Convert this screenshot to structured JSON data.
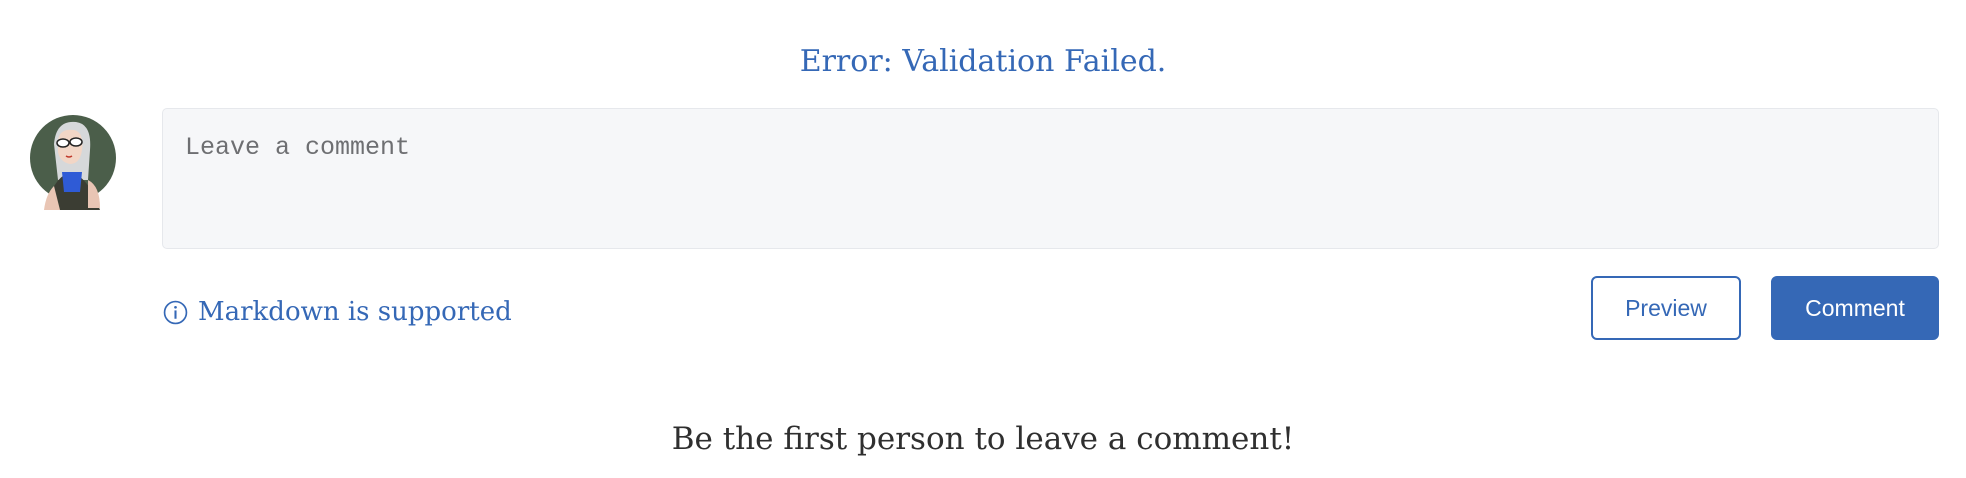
{
  "error": {
    "message": "Error: Validation Failed.",
    "color": "#3568b6"
  },
  "avatar": {
    "icon": "user-avatar-illustration"
  },
  "comment": {
    "placeholder": "Leave a comment",
    "value": ""
  },
  "hint": {
    "icon": "info-icon",
    "text": "Markdown is supported"
  },
  "actions": {
    "preview_label": "Preview",
    "comment_label": "Comment"
  },
  "empty_state": {
    "text": "Be the first person to leave a comment!"
  },
  "colors": {
    "accent": "#3568b6",
    "textarea_bg": "#f6f7f9",
    "text": "#2f2f2f"
  }
}
